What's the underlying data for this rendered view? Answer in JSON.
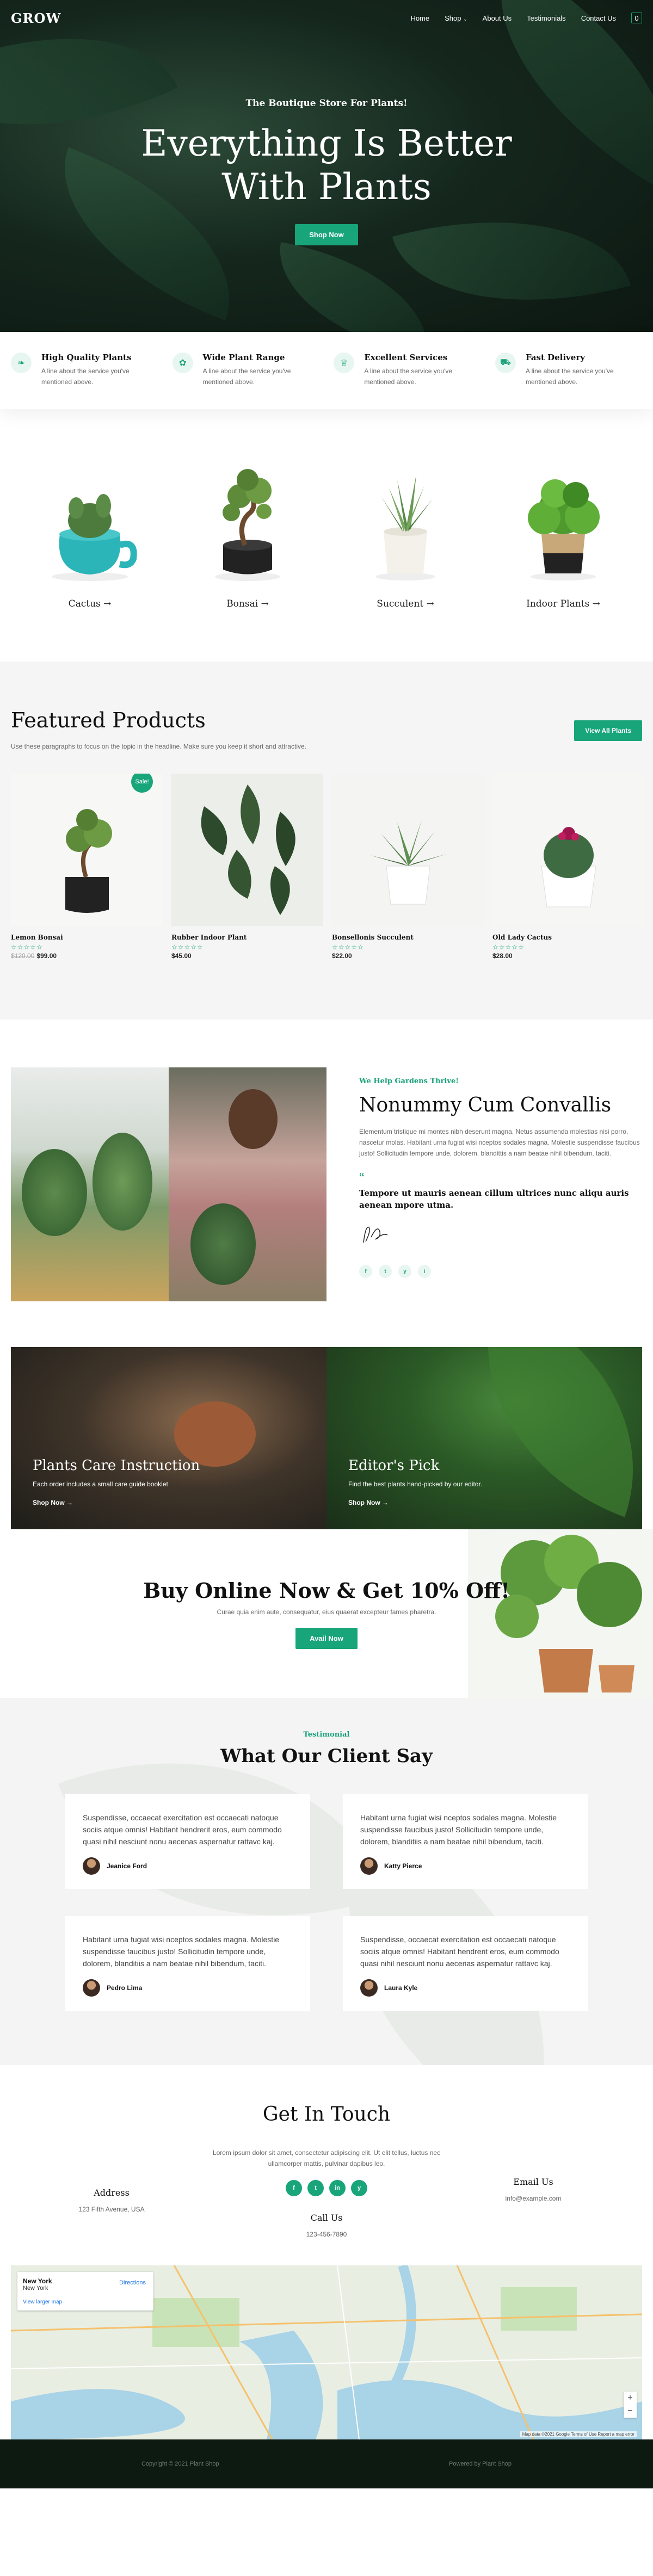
{
  "nav": {
    "logo": "GROW",
    "links": [
      "Home",
      "Shop",
      "About Us",
      "Testimonials",
      "Contact Us"
    ],
    "cart_count": "0"
  },
  "hero": {
    "subtitle": "The Boutique Store For Plants!",
    "title_line1": "Everything Is Better",
    "title_line2": "With Plants",
    "cta": "Shop Now"
  },
  "features": [
    {
      "title": "High Quality Plants",
      "text": "A line about the service you've mentioned above.",
      "icon": "leaf-icon"
    },
    {
      "title": "Wide Plant Range",
      "text": "A line about the service you've mentioned above.",
      "icon": "lotus-icon"
    },
    {
      "title": "Excellent Services",
      "text": "A line about the service you've mentioned above.",
      "icon": "trophy-icon"
    },
    {
      "title": "Fast Delivery",
      "text": "A line about the service you've mentioned above.",
      "icon": "truck-icon"
    }
  ],
  "categories": [
    "Cactus →",
    "Bonsai →",
    "Succulent →",
    "Indoor Plants →"
  ],
  "featured": {
    "title": "Featured Products",
    "description": "Use these paragraphs to focus on the topic in the headline. Make sure you keep it short and attractive.",
    "button": "View All Plants",
    "products": [
      {
        "name": "Lemon Bonsai",
        "old_price": "$120.00",
        "price": "$99.00",
        "badge": "Sale!",
        "stars": "☆☆☆☆☆"
      },
      {
        "name": "Rubber Indoor Plant",
        "old_price": "",
        "price": "$45.00",
        "badge": "",
        "stars": "☆☆☆☆☆"
      },
      {
        "name": "Bonsellonis Succulent",
        "old_price": "",
        "price": "$22.00",
        "badge": "",
        "stars": "☆☆☆☆☆"
      },
      {
        "name": "Old Lady Cactus",
        "old_price": "",
        "price": "$28.00",
        "badge": "",
        "stars": "☆☆☆☆☆"
      }
    ]
  },
  "about": {
    "kicker": "We Help Gardens Thrive!",
    "title": "Nonummy Cum Convallis",
    "body": "Elementum tristique mi montes nibh deserunt magna. Netus assumenda molestias nisi porro, nascetur molas. Habitant urna fugiat wisi nceptos sodales magna. Molestie suspendisse faucibus justo! Sollicitudin tempore unde, dolorem, blandittis a nam beatae nihil bibendum, taciti.",
    "quote": "Tempore ut mauris aenean cillum ultrices nunc aliqu auris aenean mpore utma.",
    "social": [
      "f",
      "t",
      "y",
      "i"
    ]
  },
  "promos": [
    {
      "title": "Plants Care Instruction",
      "text": "Each order includes a small care guide booklet",
      "link": "Shop Now →"
    },
    {
      "title": "Editor's Pick",
      "text": "Find the best plants hand-picked by our editor.",
      "link": "Shop Now →"
    }
  ],
  "buy": {
    "title": "Buy Online Now & Get 10% Off!",
    "text": "Curae quia enim aute, consequatur, eius quaerat excepteur fames pharetra.",
    "cta": "Avail Now"
  },
  "testimonials": {
    "kicker": "Testimonial",
    "title": "What Our Client Say",
    "items": [
      {
        "text": "Suspendisse, occaecat exercitation est occaecati natoque sociis atque omnis! Habitant hendrerit eros, eum commodo quasi nihil nesciunt nonu aecenas aspernatur rattavc kaj.",
        "name": "Jeanice Ford"
      },
      {
        "text": "Habitant urna fugiat wisi nceptos sodales magna. Molestie suspendisse faucibus justo! Sollicitudin tempore unde, dolorem, blanditiis a nam beatae nihil bibendum, taciti.",
        "name": "Katty Pierce"
      },
      {
        "text": "Habitant urna fugiat wisi nceptos sodales magna. Molestie suspendisse faucibus justo! Sollicitudin tempore unde, dolorem, blanditiis a nam beatae nihil bibendum, taciti.",
        "name": "Pedro Lima"
      },
      {
        "text": "Suspendisse, occaecat exercitation est occaecati natoque sociis atque omnis! Habitant hendrerit eros, eum commodo quasi nihil nesciunt nonu aecenas aspernatur rattavc kaj.",
        "name": "Laura Kyle"
      }
    ]
  },
  "contact": {
    "title": "Get In Touch",
    "text": "Lorem ipsum dolor sit amet, consectetur adipiscing elit. Ut elit tellus, luctus nec ullamcorper mattis, pulvinar dapibus leo.",
    "social": [
      "f",
      "t",
      "in",
      "y"
    ],
    "address_title": "Address",
    "address": "123 Fifth Avenue, USA",
    "email_title": "Email Us",
    "email": "info@example.com",
    "call_title": "Call Us",
    "phone": "123-456-7890"
  },
  "map": {
    "place": "New York",
    "region": "New York",
    "directions": "Directions",
    "larger": "View larger map",
    "footer": "Map data ©2021 Google   Terms of Use   Report a map error"
  },
  "footer": {
    "left": "Copyright © 2021 Plant Shop",
    "right": "Powered by Plant Shop"
  }
}
